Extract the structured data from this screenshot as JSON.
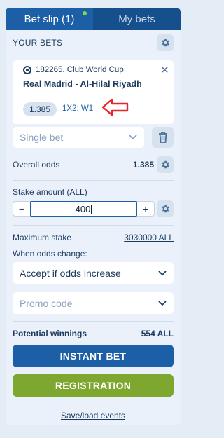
{
  "tabs": [
    {
      "label": "Bet slip (1)",
      "active": true
    },
    {
      "label": "My bets",
      "active": false
    }
  ],
  "your_bets": {
    "title": "YOUR BETS",
    "bet": {
      "event_line": "182265. Club World Cup",
      "match": "Real Madrid - Al-Hilal Riyadh",
      "odds": "1.385",
      "market": "1X2: W1"
    }
  },
  "bet_type": {
    "selected": "Single bet"
  },
  "overall_odds": {
    "label": "Overall odds",
    "value": "1.385"
  },
  "stake": {
    "label": "Stake amount (ALL)",
    "value": "400",
    "minus": "−",
    "plus": "+"
  },
  "max_stake": {
    "label": "Maximum stake",
    "value": "3030000 ALL"
  },
  "odds_change": {
    "label": "When odds change:",
    "selected": "Accept if odds increase"
  },
  "promo": {
    "placeholder": "Promo code"
  },
  "winnings": {
    "label": "Potential winnings",
    "value": "554 ALL"
  },
  "buttons": {
    "instant_bet": "INSTANT BET",
    "registration": "REGISTRATION"
  },
  "footer": {
    "link": "Save/load events"
  },
  "colors": {
    "primary": "#1d5fa6",
    "green": "#7da72e",
    "annotation": "#e5262e"
  },
  "icons": [
    "gear-icon",
    "soccer-ball-icon",
    "close-icon",
    "chevron-down-icon",
    "trash-icon"
  ]
}
